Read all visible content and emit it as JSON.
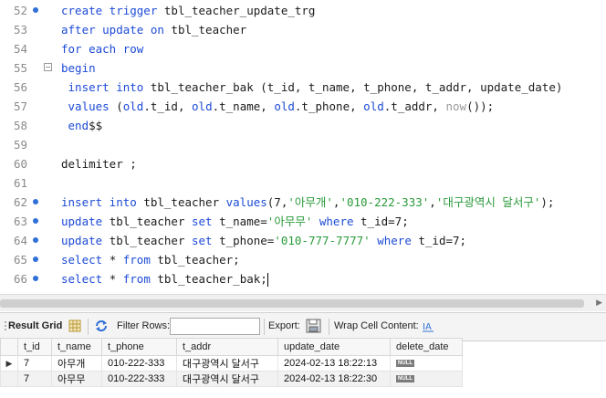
{
  "editor": {
    "lines": [
      {
        "num": "52",
        "dot": true,
        "fold": false,
        "parts": [
          [
            "kw",
            "create trigger "
          ],
          [
            "",
            "tbl_teacher_update_trg"
          ]
        ]
      },
      {
        "num": "53",
        "dot": false,
        "fold": false,
        "parts": [
          [
            "kw",
            "after update on "
          ],
          [
            "",
            "tbl_teacher"
          ]
        ]
      },
      {
        "num": "54",
        "dot": false,
        "fold": false,
        "parts": [
          [
            "kw",
            "for each row"
          ]
        ]
      },
      {
        "num": "55",
        "dot": false,
        "fold": true,
        "parts": [
          [
            "kw",
            "begin"
          ]
        ]
      },
      {
        "num": "56",
        "dot": false,
        "fold": false,
        "parts": [
          [
            "kw",
            " insert into "
          ],
          [
            "",
            "tbl_teacher_bak (t_id, t_name, t_phone, t_addr, update_date)"
          ]
        ]
      },
      {
        "num": "57",
        "dot": false,
        "fold": false,
        "parts": [
          [
            "kw",
            " values "
          ],
          [
            "",
            "("
          ],
          [
            "kw",
            "old"
          ],
          [
            "",
            ".t_id, "
          ],
          [
            "kw",
            "old"
          ],
          [
            "",
            ".t_name, "
          ],
          [
            "kw",
            "old"
          ],
          [
            "",
            ".t_phone, "
          ],
          [
            "kw",
            "old"
          ],
          [
            "",
            ".t_addr, "
          ],
          [
            "fn",
            "now"
          ],
          [
            "",
            "());"
          ]
        ]
      },
      {
        "num": "58",
        "dot": false,
        "fold": false,
        "parts": [
          [
            "kw",
            " end"
          ],
          [
            "",
            "$$"
          ]
        ]
      },
      {
        "num": "59",
        "dot": false,
        "fold": false,
        "parts": []
      },
      {
        "num": "60",
        "dot": false,
        "fold": false,
        "parts": [
          [
            "",
            "delimiter ;"
          ]
        ]
      },
      {
        "num": "61",
        "dot": false,
        "fold": false,
        "parts": []
      },
      {
        "num": "62",
        "dot": true,
        "fold": false,
        "parts": [
          [
            "kw",
            "insert into "
          ],
          [
            "",
            "tbl_teacher "
          ],
          [
            "kw",
            "values"
          ],
          [
            "",
            "(7,"
          ],
          [
            "str",
            "'아무개'"
          ],
          [
            "",
            ","
          ],
          [
            "str",
            "'010-222-333'"
          ],
          [
            "",
            ","
          ],
          [
            "str",
            "'대구광역시 달서구'"
          ],
          [
            "",
            ");"
          ]
        ]
      },
      {
        "num": "63",
        "dot": true,
        "fold": false,
        "parts": [
          [
            "kw",
            "update "
          ],
          [
            "",
            "tbl_teacher "
          ],
          [
            "kw",
            "set "
          ],
          [
            "",
            "t_name="
          ],
          [
            "str",
            "'아무무'"
          ],
          [
            "kw",
            " where "
          ],
          [
            "",
            "t_id=7;"
          ]
        ]
      },
      {
        "num": "64",
        "dot": true,
        "fold": false,
        "parts": [
          [
            "kw",
            "update "
          ],
          [
            "",
            "tbl_teacher "
          ],
          [
            "kw",
            "set "
          ],
          [
            "",
            "t_phone="
          ],
          [
            "str",
            "'010-777-7777'"
          ],
          [
            "kw",
            " where "
          ],
          [
            "",
            "t_id=7;"
          ]
        ]
      },
      {
        "num": "65",
        "dot": true,
        "fold": false,
        "parts": [
          [
            "kw",
            "select "
          ],
          [
            "",
            "* "
          ],
          [
            "kw",
            "from "
          ],
          [
            "",
            "tbl_teacher;"
          ]
        ]
      },
      {
        "num": "66",
        "dot": true,
        "fold": false,
        "caret": true,
        "parts": [
          [
            "kw",
            "select "
          ],
          [
            "",
            "* "
          ],
          [
            "kw",
            "from "
          ],
          [
            "",
            "tbl_teacher_bak;"
          ]
        ]
      }
    ]
  },
  "toolbar": {
    "result_grid": "Result Grid",
    "filter_rows": "Filter Rows:",
    "filter_value": "",
    "export": "Export:",
    "wrap_cell": "Wrap Cell Content:"
  },
  "grid": {
    "columns": [
      "t_id",
      "t_name",
      "t_phone",
      "t_addr",
      "update_date",
      "delete_date"
    ],
    "rows": [
      [
        "7",
        "아무개",
        "010-222-333",
        "대구광역시 달서구",
        "2024-02-13 18:22:13",
        "NULL"
      ],
      [
        "7",
        "아무무",
        "010-222-333",
        "대구광역시 달서구",
        "2024-02-13 18:22:30",
        "NULL"
      ]
    ]
  },
  "colors": {
    "keyword": "#1d4bd6",
    "string": "#2a9a3a",
    "accent": "#2f6fd8"
  }
}
